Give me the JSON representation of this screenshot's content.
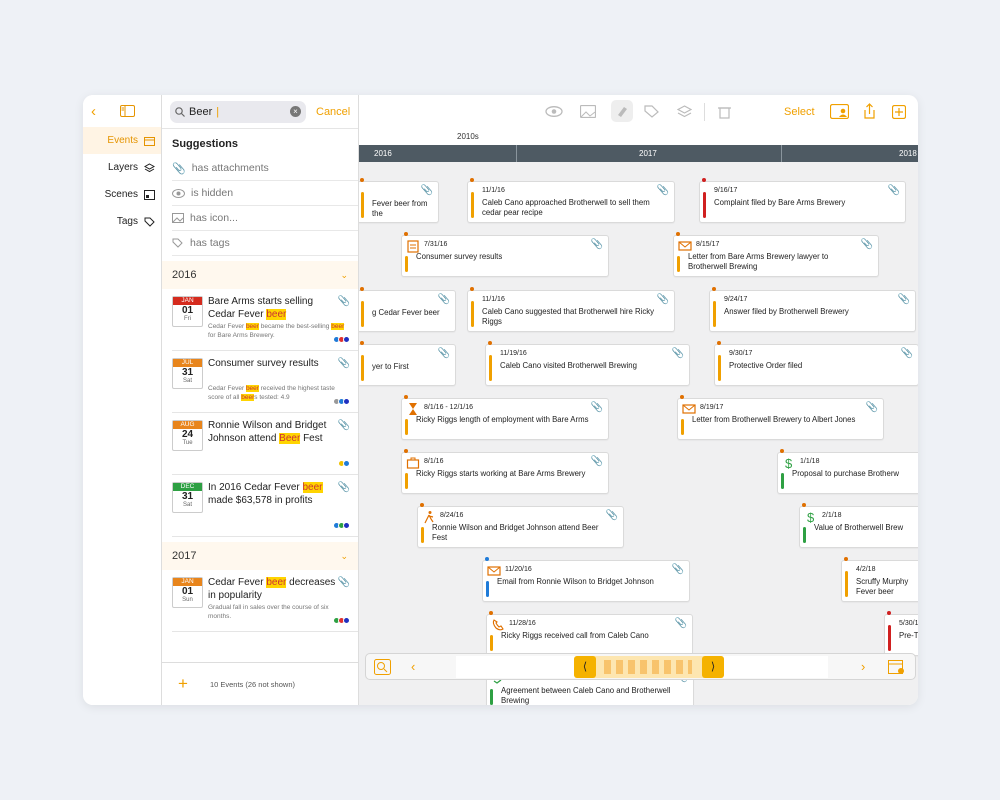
{
  "rail": {
    "items": [
      {
        "label": "Events",
        "active": true
      },
      {
        "label": "Layers"
      },
      {
        "label": "Scenes"
      },
      {
        "label": "Tags"
      }
    ]
  },
  "search": {
    "value": "Beer",
    "cancel": "Cancel"
  },
  "suggestions": {
    "title": "Suggestions",
    "items": [
      "has attachments",
      "is hidden",
      "has icon...",
      "has tags"
    ]
  },
  "groups": [
    {
      "year": "2016",
      "events": [
        {
          "mon": "JAN",
          "day": "01",
          "dow": "Fri",
          "color": "#d52b1e",
          "title": [
            "Bare Arms starts selling Cedar Fever ",
            "beer",
            ""
          ],
          "sub": [
            "Cedar Fever ",
            "beer",
            " became the best-selling ",
            "beer",
            " for Bare Arms Brewery."
          ],
          "dots": [
            "#1f7bd8",
            "#e03030",
            "#2030c0"
          ]
        },
        {
          "mon": "JUL",
          "day": "31",
          "dow": "Sat",
          "color": "#e8851c",
          "title": [
            "Consumer survey results",
            "",
            ""
          ],
          "sub": [
            "Cedar Fever ",
            "beer",
            " received the highest taste score of all ",
            "beer",
            "s tested: 4.9"
          ],
          "dots": [
            "#999",
            "#1f7bd8",
            "#2030c0"
          ]
        },
        {
          "mon": "AUG",
          "day": "24",
          "dow": "Tue",
          "color": "#e8851c",
          "title": [
            "Ronnie Wilson and Bridget Johnson attend ",
            "Beer",
            " Fest"
          ],
          "sub": [],
          "dots": [
            "#f0c000",
            "#1f7bd8"
          ]
        },
        {
          "mon": "DEC",
          "day": "31",
          "dow": "Sat",
          "color": "#2ea043",
          "title": [
            "In 2016 Cedar Fever ",
            "beer",
            " made $63,578 in profits"
          ],
          "sub": [],
          "dots": [
            "#1f7bd8",
            "#2ea043",
            "#2030c0"
          ]
        }
      ]
    },
    {
      "year": "2017",
      "events": [
        {
          "mon": "JAN",
          "day": "01",
          "dow": "Sun",
          "color": "#e8851c",
          "title": [
            "Cedar Fever ",
            "beer",
            " decreases in popularity"
          ],
          "sub": [
            "Gradual fall in sales over the course of six months."
          ],
          "dots": [
            "#2ea043",
            "#e03030",
            "#2030c0"
          ]
        }
      ]
    }
  ],
  "footer": {
    "count": "10 Events (26 not shown)"
  },
  "toolbar": {
    "select": "Select"
  },
  "timeline": {
    "decade": "2010s",
    "years": [
      "2016",
      "2017",
      "2018"
    ]
  },
  "cards": [
    {
      "date": "",
      "title": "Fever beer from the",
      "bar": "#f0a000"
    },
    {
      "date": "11/1/16",
      "title": "Caleb Cano approached Brotherwell to sell them cedar pear recipe",
      "bar": "#f0a000"
    },
    {
      "date": "9/16/17",
      "title": "Complaint filed by Bare Arms Brewery",
      "bar": "#d02020"
    },
    {
      "date": "7/31/16",
      "title": "Consumer survey results",
      "bar": "#f0a000",
      "icon": "clipboard-icon"
    },
    {
      "date": "8/15/17",
      "title": "Letter from Bare Arms Brewery lawyer to Brotherwell Brewing",
      "bar": "#f0a000",
      "icon": "envelope-icon"
    },
    {
      "date": "",
      "title": "g Cedar Fever beer",
      "bar": "#f0a000"
    },
    {
      "date": "11/1/16",
      "title": "Caleb Cano suggested that Brotherwell hire Ricky Riggs",
      "bar": "#f0a000"
    },
    {
      "date": "9/24/17",
      "title": "Answer filed by Brotherwell Brewery",
      "bar": "#f0a000"
    },
    {
      "date": "",
      "title": "yer to First",
      "bar": "#f0a000"
    },
    {
      "date": "11/19/16",
      "title": "Caleb Cano visited Brotherwell Brewing",
      "bar": "#f0a000"
    },
    {
      "date": "9/30/17",
      "title": "Protective Order filed",
      "bar": "#f0a000"
    },
    {
      "date": "8/1/16 - 12/1/16",
      "title": "Ricky Riggs length of employment with Bare Arms",
      "bar": "#f0a000",
      "icon": "hourglass-icon"
    },
    {
      "date": "8/19/17",
      "title": "Letter from Brotherwell Brewery to Albert Jones",
      "bar": "#f0a000",
      "icon": "envelope-icon"
    },
    {
      "date": "8/1/16",
      "title": "Ricky Riggs starts working at Bare Arms Brewery",
      "bar": "#f0a000",
      "icon": "briefcase-icon"
    },
    {
      "date": "1/1/18",
      "title": "Proposal to purchase Brotherw",
      "bar": "#2ea043",
      "icon": "dollar-icon"
    },
    {
      "date": "8/24/16",
      "title": "Ronnie Wilson and Bridget Johnson attend Beer Fest",
      "bar": "#f0a000",
      "icon": "walker-icon"
    },
    {
      "date": "2/1/18",
      "title": "Value of Brotherwell Brew",
      "bar": "#2ea043",
      "icon": "dollar-icon"
    },
    {
      "date": "11/20/16",
      "title": "Email from Ronnie Wilson to Bridget Johnson",
      "bar": "#1f7bd8",
      "icon": "envelope-icon"
    },
    {
      "date": "4/2/18",
      "title": "Scruffy Murphy Fever beer",
      "bar": "#f0a000"
    },
    {
      "date": "11/28/16",
      "title": "Ricky Riggs received call from Caleb Cano",
      "bar": "#f0a000",
      "icon": "phone-icon"
    },
    {
      "date": "5/30/1",
      "title": "Pre-T",
      "bar": "#d02020"
    },
    {
      "date": "",
      "title": "Agreement between Caleb Cano and Brotherwell Brewing",
      "bar": "#2ea043",
      "icon": "handshake-icon"
    }
  ]
}
